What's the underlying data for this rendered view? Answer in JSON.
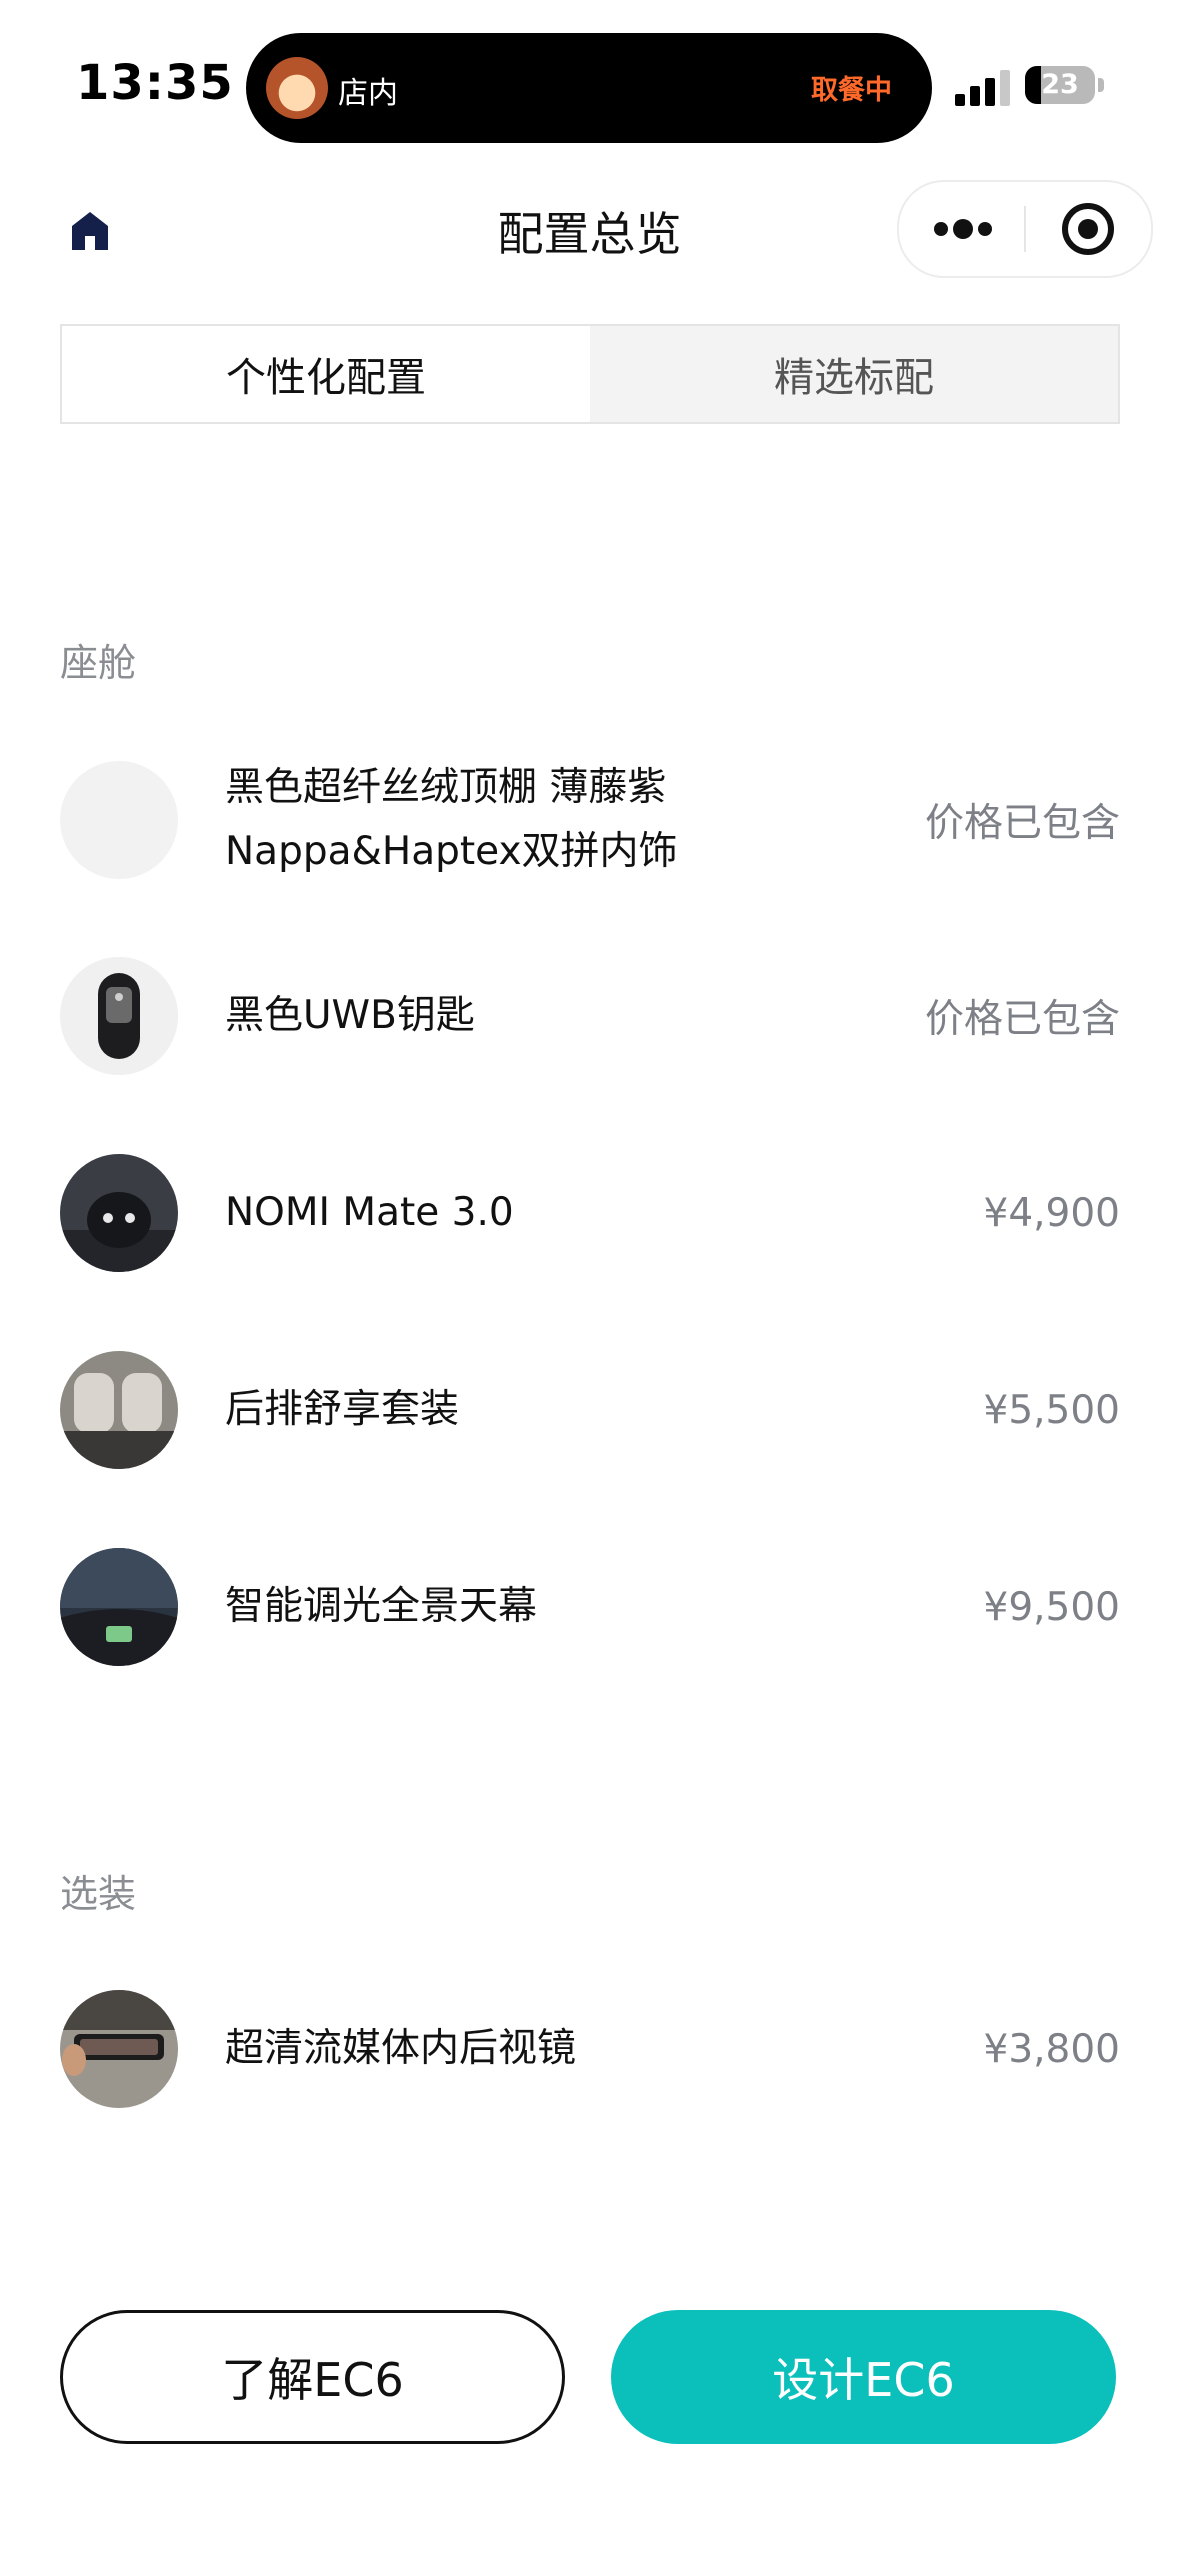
{
  "status_bar": {
    "time": "13:35",
    "island_label": "店内",
    "island_status": "取餐中",
    "battery": "23"
  },
  "nav": {
    "title": "配置总览",
    "icons": [
      "home-icon",
      "more-icon",
      "target-icon"
    ]
  },
  "tabs": [
    {
      "label": "个性化配置",
      "active": true
    },
    {
      "label": "精选标配",
      "active": false
    }
  ],
  "sections": [
    {
      "title": "座舱",
      "items": [
        {
          "name": "黑色超纤丝绒顶棚 薄藤紫 Nappa&Haptex双拼内饰",
          "price": "价格已包含"
        },
        {
          "name": "黑色UWB钥匙",
          "price": "价格已包含"
        },
        {
          "name": "NOMI Mate 3.0",
          "price": "¥4,900"
        },
        {
          "name": "后排舒享套装",
          "price": "¥5,500"
        },
        {
          "name": "智能调光全景天幕",
          "price": "¥9,500"
        }
      ]
    },
    {
      "title": "选装",
      "items": [
        {
          "name": "超清流媒体内后视镜",
          "price": "¥3,800"
        }
      ]
    }
  ],
  "buttons": {
    "learn": "了解EC6",
    "design": "设计EC6"
  },
  "colors": {
    "accent": "#0bbfbb",
    "island_status": "#ff6a2a",
    "muted_text": "#8a8d92"
  }
}
